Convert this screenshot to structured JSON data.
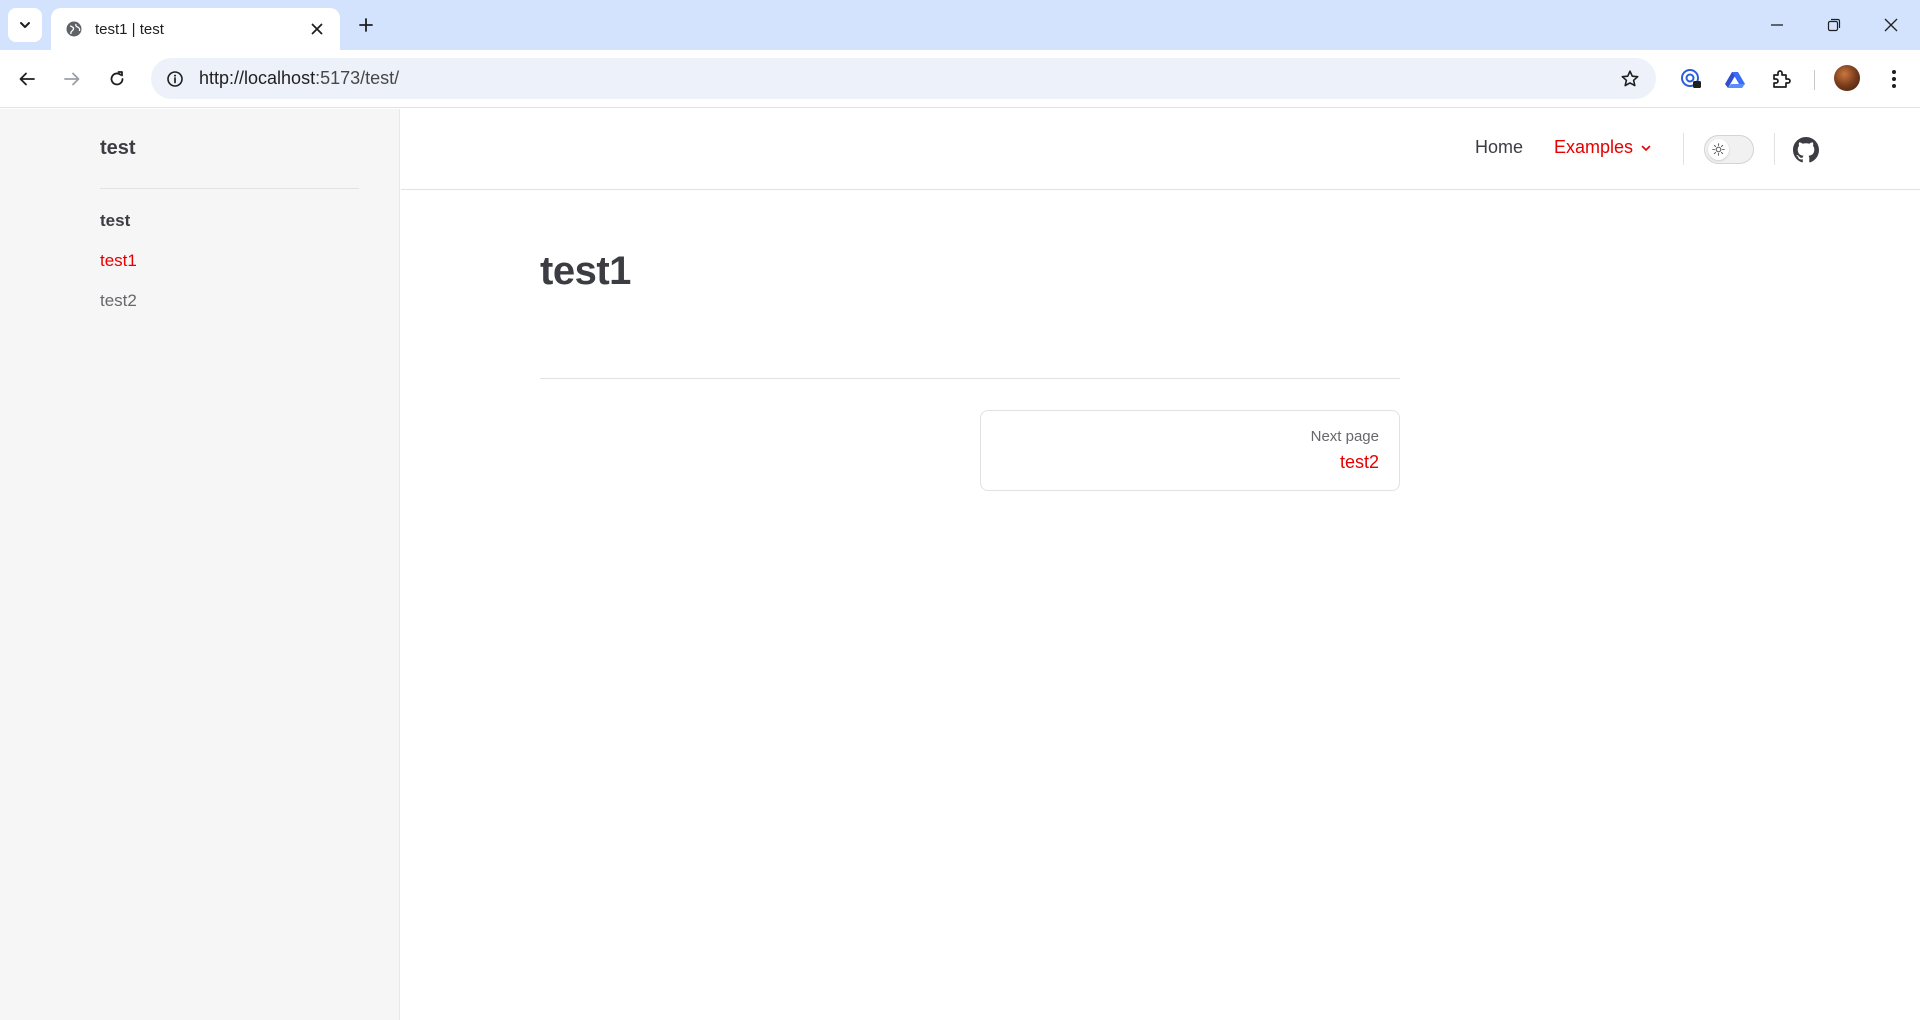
{
  "browser": {
    "tab_title": "test1 | test",
    "url_host": "http://localhost",
    "url_rest": ":5173/test/"
  },
  "site": {
    "sidebar_title": "test",
    "sidebar_group": "test",
    "sidebar_items": [
      "test1",
      "test2"
    ],
    "nav_home": "Home",
    "nav_examples": "Examples",
    "accent_color": "#e60000"
  },
  "doc": {
    "title": "test1",
    "next_label": "Next page",
    "next_title": "test2"
  },
  "icons": [
    "chevron-down-icon",
    "globe-icon",
    "close-icon",
    "plus-icon",
    "minimize-icon",
    "restore-icon",
    "back-arrow-icon",
    "forward-arrow-icon",
    "reload-icon",
    "info-icon",
    "star-icon",
    "puzzle-icon",
    "sun-icon",
    "github-icon"
  ]
}
